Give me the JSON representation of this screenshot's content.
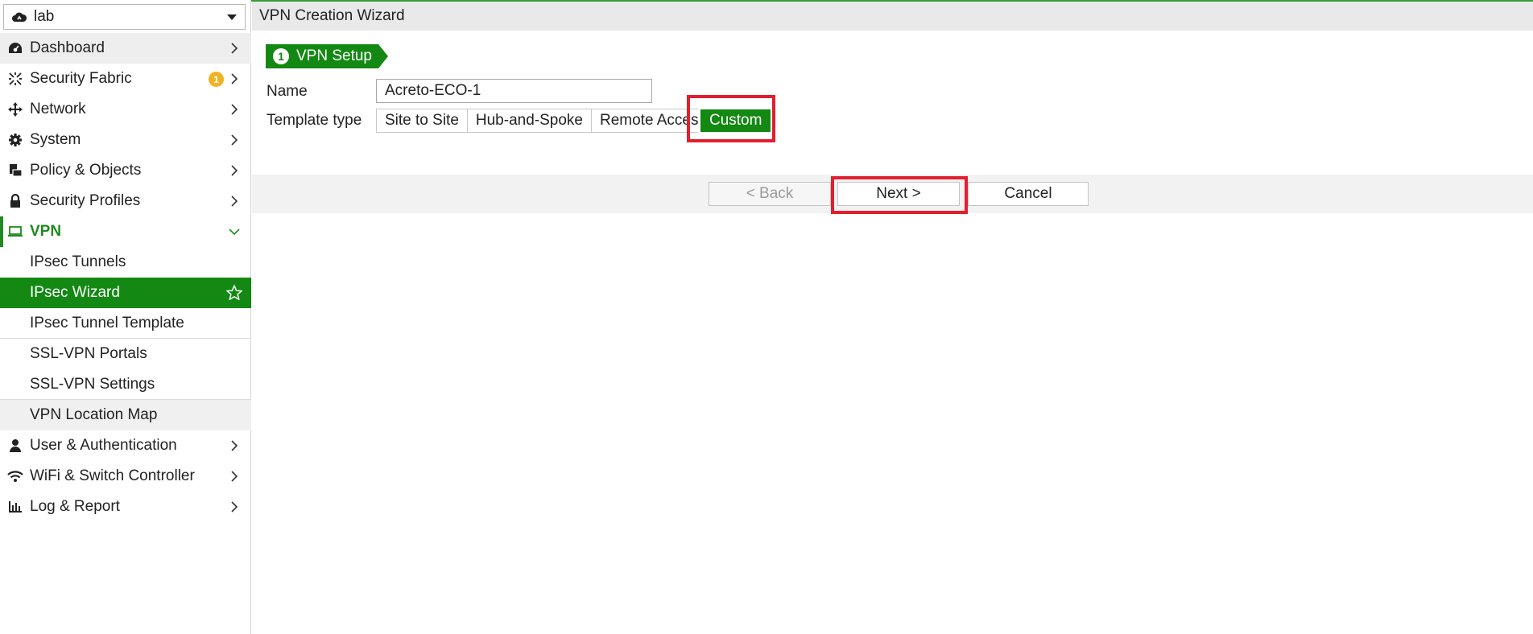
{
  "vdom": {
    "value": "lab",
    "icon": "cloud-icon"
  },
  "sidebar": {
    "items": [
      {
        "label": "Dashboard",
        "icon": "dashboard-icon"
      },
      {
        "label": "Security Fabric",
        "icon": "fabric-icon",
        "badge": "1"
      },
      {
        "label": "Network",
        "icon": "network-icon"
      },
      {
        "label": "System",
        "icon": "gear-icon"
      },
      {
        "label": "Policy & Objects",
        "icon": "policy-icon"
      },
      {
        "label": "Security Profiles",
        "icon": "lock-icon"
      },
      {
        "label": "VPN",
        "icon": "laptop-icon"
      }
    ],
    "vpn_sub": [
      "IPsec Tunnels",
      "IPsec Wizard",
      "IPsec Tunnel Template",
      "SSL-VPN Portals",
      "SSL-VPN Settings",
      "VPN Location Map"
    ],
    "items_after": [
      {
        "label": "User & Authentication",
        "icon": "user-icon"
      },
      {
        "label": "WiFi & Switch Controller",
        "icon": "wifi-icon"
      },
      {
        "label": "Log & Report",
        "icon": "report-icon"
      }
    ]
  },
  "header": {
    "title": "VPN Creation Wizard"
  },
  "step": {
    "number": "1",
    "label": "VPN Setup"
  },
  "form": {
    "name_label": "Name",
    "name_value": "Acreto-ECO-1",
    "template_label": "Template type",
    "template_options": [
      "Site to Site",
      "Hub-and-Spoke",
      "Remote Access",
      "Custom"
    ],
    "template_selected": "Custom"
  },
  "buttons": {
    "back": "< Back",
    "next": "Next >",
    "cancel": "Cancel"
  },
  "colors": {
    "accent": "#138913",
    "highlight": "#e0202e",
    "badge": "#f0b324"
  }
}
